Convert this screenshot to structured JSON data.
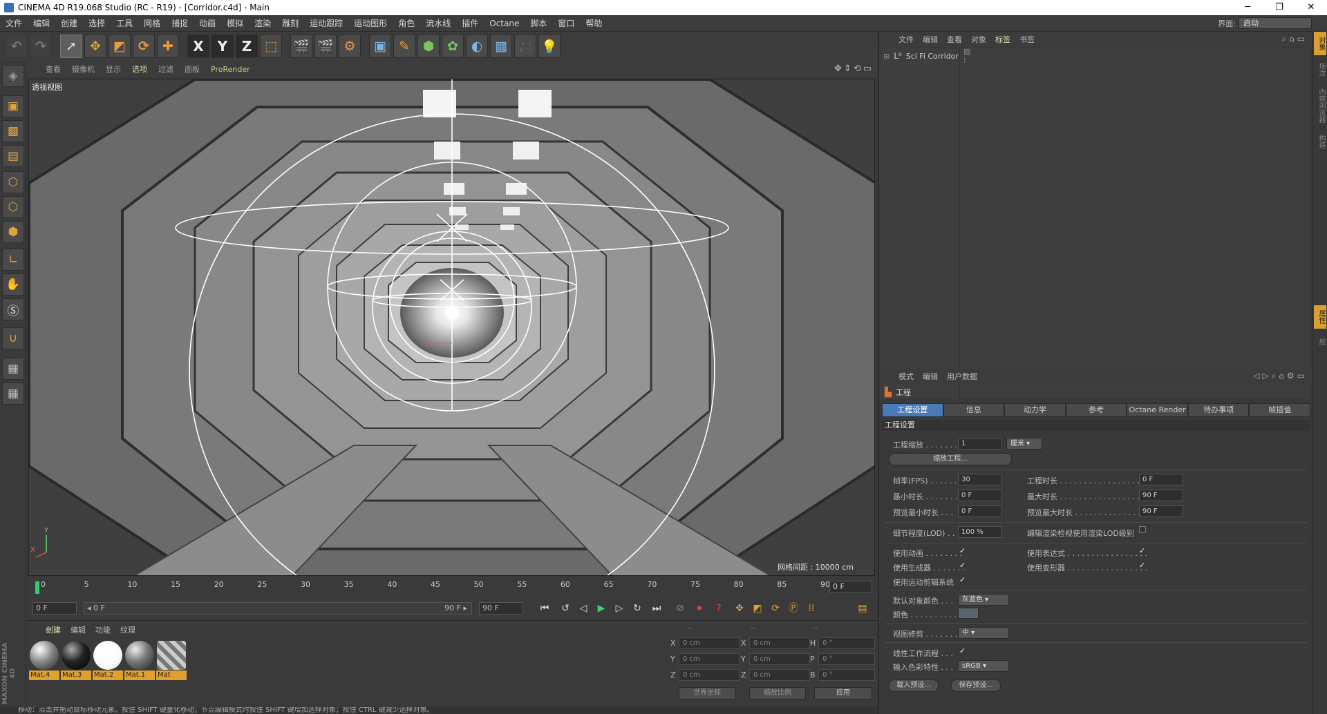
{
  "window": {
    "title": "CINEMA 4D R19.068 Studio (RC - R19) - [Corridor.c4d] - Main",
    "minimize": "─",
    "maximize": "❐",
    "close": "✕"
  },
  "menu": [
    "文件",
    "编辑",
    "创建",
    "选择",
    "工具",
    "网格",
    "捕捉",
    "动画",
    "模拟",
    "渲染",
    "雕刻",
    "运动跟踪",
    "运动图形",
    "角色",
    "流水线",
    "插件",
    "Octane",
    "脚本",
    "窗口",
    "帮助"
  ],
  "interface": {
    "label": "界面:",
    "value": "启动"
  },
  "toolbar": {
    "x": "X",
    "y": "Y",
    "z": "Z"
  },
  "viewport": {
    "tabs": [
      "查看",
      "摄像机",
      "显示",
      "选项",
      "过滤",
      "面板",
      "ProRender"
    ],
    "active_tab": "选项",
    "label": "透视视图",
    "grid_spacing": "网格间距 : 10000 cm",
    "axis_y": "Y",
    "axis_x": "X"
  },
  "timeline": {
    "ticks": [
      "0",
      "5",
      "10",
      "15",
      "20",
      "25",
      "30",
      "35",
      "40",
      "45",
      "50",
      "55",
      "60",
      "65",
      "70",
      "75",
      "80",
      "85",
      "90"
    ],
    "current": "0 F",
    "start": "0 F",
    "range_start": "◂ 0 F",
    "range_end": "90 F ▸",
    "end": "90 F"
  },
  "materials": {
    "tabs": [
      "创建",
      "编辑",
      "功能",
      "纹理"
    ],
    "items": [
      "Mat.4",
      "Mat.3",
      "Mat.2",
      "Mat.1",
      "Mat"
    ]
  },
  "coords": {
    "headers": [
      "--",
      "--",
      "--"
    ],
    "rows": [
      {
        "a": "X",
        "av": "0 cm",
        "b": "X",
        "bv": "0 cm",
        "c": "H",
        "cv": "0 °"
      },
      {
        "a": "Y",
        "av": "0 cm",
        "b": "Y",
        "bv": "0 cm",
        "c": "P",
        "cv": "0 °"
      },
      {
        "a": "Z",
        "av": "0 cm",
        "b": "Z",
        "bv": "0 cm",
        "c": "B",
        "cv": "0 °"
      }
    ],
    "world": "世界坐标",
    "scale": "缩放比例",
    "apply": "应用"
  },
  "brand": "MAXON CINEMA 4D",
  "status": "移动：点击并拖动鼠标移动元素。按住 SHIFT 键量化移动；节点编辑模式时按住 SHIFT 键增加选择对象；按住 CTRL 键减少选择对象。",
  "objects": {
    "menu": [
      "文件",
      "编辑",
      "查看",
      "对象",
      "标签",
      "书签"
    ],
    "active_menu": "标签",
    "item": "Sci Fi Corridor"
  },
  "attributes": {
    "menu": [
      "模式",
      "编辑",
      "用户数据"
    ],
    "title": "工程",
    "tabs": [
      "工程设置",
      "信息",
      "动力学",
      "参考",
      "Octane Render",
      "待办事项",
      "帧插值"
    ],
    "active_tab": "工程设置",
    "section": "工程设置",
    "scale_label": "工程缩放 . . . . . . . .",
    "scale_value": "1",
    "scale_unit": "厘米",
    "scale_button": "缩放工程...",
    "fps_label": "帧率(FPS) . . . . . . .",
    "fps_value": "30",
    "proj_time_label": "工程时长 . . . . . . . . . . . . . . . . . . .",
    "proj_time_value": "0 F",
    "min_time_label": "最小时长 . . . . . . . .",
    "min_time_value": "0 F",
    "max_time_label": "最大时长 . . . . . . . . . . . . . . . . . . .",
    "max_time_value": "90 F",
    "prev_min_label": "预览最小时长 . . .",
    "prev_min_value": "0 F",
    "prev_max_label": "预览最大时长 . . . . . . . . . . . . . . .",
    "prev_max_value": "90 F",
    "lod_label": "细节程度(LOD) . . .",
    "lod_value": "100 %",
    "lod_render_label": "编辑渲染检视使用渲染LOD级别",
    "use_anim": "使用动画 . . . . . . . .",
    "use_expr": "使用表达式 . . . . . . . . . . . . . . . . .",
    "use_gen": "使用生成器 . . . . . . .",
    "use_deform": "使用变形器 . . . . . . . . . . . . . . . . .",
    "use_motion": "使用运动剪辑系统",
    "def_color_label": "默认对象颜色 . . .",
    "def_color_value": "灰蓝色",
    "color_label": "颜色 . . . . . . . . . . .",
    "clip_label": "视图修剪 . . . . . . .",
    "clip_value": "中",
    "linear_label": "线性工作流程 . . .",
    "input_color_label": "输入色彩特性 . . .",
    "input_color_value": "sRGB",
    "load_preset": "载入预设...",
    "save_preset": "保存预设...",
    "check": "✓"
  },
  "side_tabs": [
    "对象",
    "场次",
    "内容浏览器",
    "构造",
    "属性",
    "层"
  ]
}
